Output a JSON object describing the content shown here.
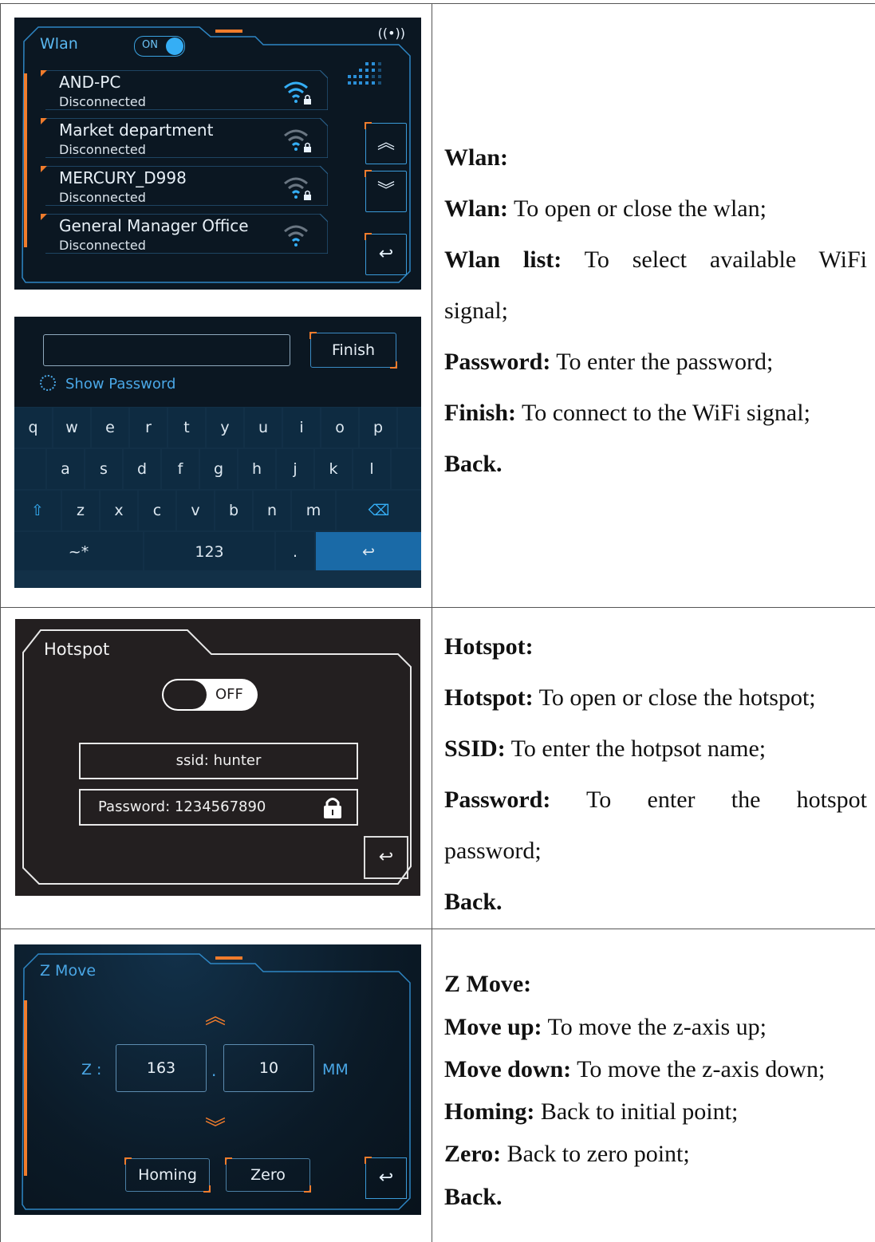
{
  "wlan": {
    "title": "Wlan",
    "toggle_label": "ON",
    "broadcast_icon": "((•))",
    "networks": [
      {
        "name": "AND-PC",
        "status": "Disconnected"
      },
      {
        "name": "Market department",
        "status": "Disconnected"
      },
      {
        "name": "MERCURY_D998",
        "status": "Disconnected"
      },
      {
        "name": "General Manager Office",
        "status": "Disconnected"
      }
    ],
    "up_icon": "︽",
    "down_icon": "︾",
    "back_icon": "↩"
  },
  "keyboard": {
    "finish_label": "Finish",
    "show_password_label": "Show Password",
    "row1": [
      "q",
      "w",
      "e",
      "r",
      "t",
      "y",
      "u",
      "i",
      "o",
      "p"
    ],
    "row2": [
      "a",
      "s",
      "d",
      "f",
      "g",
      "h",
      "j",
      "k",
      "l"
    ],
    "row3": [
      "z",
      "x",
      "c",
      "v",
      "b",
      "n",
      "m"
    ],
    "shift_icon": "⇧",
    "backspace_icon": "⌫",
    "symbols_label": "~*",
    "numbers_label": "123",
    "dot_label": ".",
    "enter_icon": "↩"
  },
  "hotspot": {
    "title": "Hotspot",
    "toggle_label": "OFF",
    "ssid_field": "ssid: hunter",
    "password_field": "Password: 1234567890",
    "back_icon": "↩"
  },
  "zmove": {
    "title": "Z Move",
    "axis_label": "Z :",
    "integer_value": "163",
    "separator": ".",
    "decimal_value": "10",
    "unit": "MM",
    "up_icon": "︽",
    "down_icon": "︾",
    "homing_label": "Homing",
    "zero_label": "Zero",
    "back_icon": "↩"
  },
  "descriptions": {
    "wlan": {
      "heading": "Wlan:",
      "wlan_term": "Wlan:",
      "wlan_text": " To open or close the wlan;",
      "list_term": "Wlan list:",
      "list_text": " To select available WiFi",
      "list_text_cont": "signal;",
      "password_term": "Password:",
      "password_text": " To enter the password;",
      "finish_term": "Finish:",
      "finish_text": " To connect to the WiFi signal;",
      "back": "Back."
    },
    "hotspot": {
      "heading": "Hotspot:",
      "hotspot_term": "Hotspot:",
      "hotspot_text": " To open or close the hotspot;",
      "ssid_term": "SSID:",
      "ssid_text": " To enter the hotpsot name;",
      "password_term": "Password:",
      "password_text": " To enter the hotspot",
      "password_text_cont": "password;",
      "back": "Back."
    },
    "zmove": {
      "heading": "Z Move:",
      "up_term": "Move up:",
      "up_text": " To move the z-axis up;",
      "down_term": "Move down:",
      "down_text": " To move the z-axis down;",
      "homing_term": "Homing:",
      "homing_text": " Back to initial point;",
      "zero_term": "Zero:",
      "zero_text": " Back to zero point;",
      "back": "Back."
    }
  }
}
